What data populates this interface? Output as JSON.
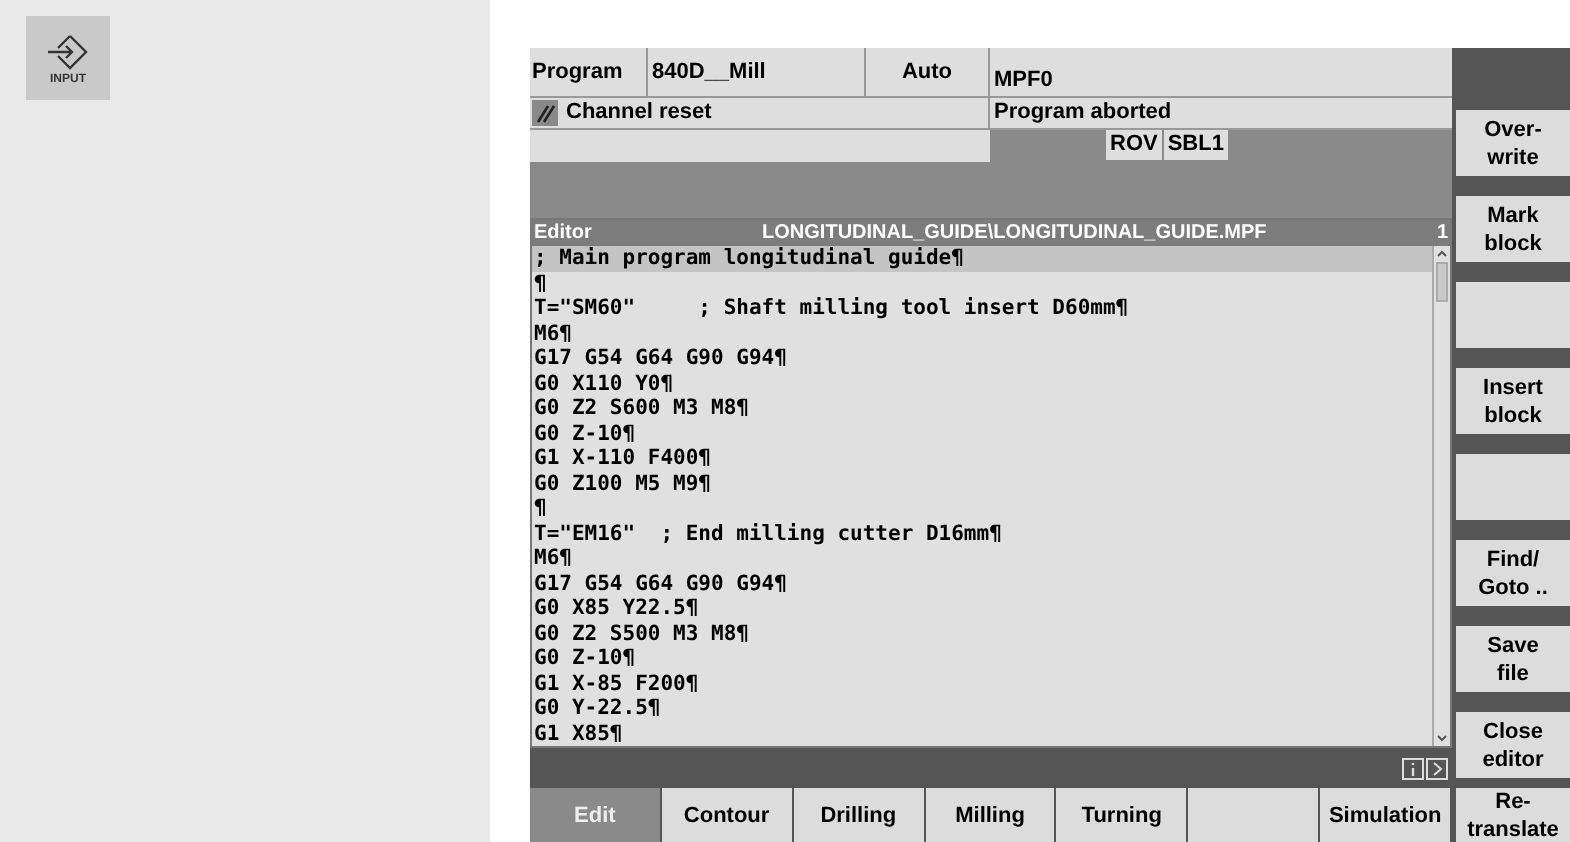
{
  "input_key": {
    "label": "INPUT"
  },
  "header": {
    "area": "Program",
    "machine": "840D__Mill",
    "mode": "Auto",
    "program_name": "MPF0",
    "channel_status": "Channel reset",
    "program_status": "Program aborted",
    "indicators": [
      "ROV",
      "SBL1"
    ]
  },
  "editor": {
    "title": "Editor",
    "file_path": "LONGITUDINAL_GUIDE\\LONGITUDINAL_GUIDE.MPF",
    "channel": "1",
    "lines": [
      {
        "text": "; Main program longitudinal guide¶",
        "selected": true
      },
      {
        "text": "¶",
        "selected": false
      },
      {
        "text": "T=\"SM60\"     ; Shaft milling tool insert D60mm¶",
        "selected": false
      },
      {
        "text": "M6¶",
        "selected": false
      },
      {
        "text": "G17 G54 G64 G90 G94¶",
        "selected": false
      },
      {
        "text": "G0 X110 Y0¶",
        "selected": false
      },
      {
        "text": "G0 Z2 S600 M3 M8¶",
        "selected": false
      },
      {
        "text": "G0 Z-10¶",
        "selected": false
      },
      {
        "text": "G1 X-110 F400¶",
        "selected": false
      },
      {
        "text": "G0 Z100 M5 M9¶",
        "selected": false
      },
      {
        "text": "¶",
        "selected": false
      },
      {
        "text": "T=\"EM16\"  ; End milling cutter D16mm¶",
        "selected": false
      },
      {
        "text": "M6¶",
        "selected": false
      },
      {
        "text": "G17 G54 G64 G90 G94¶",
        "selected": false
      },
      {
        "text": "G0 X85 Y22.5¶",
        "selected": false
      },
      {
        "text": "G0 Z2 S500 M3 M8¶",
        "selected": false
      },
      {
        "text": "G0 Z-10¶",
        "selected": false
      },
      {
        "text": "G1 X-85 F200¶",
        "selected": false
      },
      {
        "text": "G0 Y-22.5¶",
        "selected": false
      },
      {
        "text": "G1 X85¶",
        "selected": false
      }
    ]
  },
  "softkeys_bottom": [
    {
      "kind": "key",
      "label": "Edit",
      "selected": true
    },
    {
      "kind": "key",
      "label": "Contour",
      "selected": false
    },
    {
      "kind": "key",
      "label": "Drilling",
      "selected": false
    },
    {
      "kind": "key",
      "label": "Milling",
      "selected": false
    },
    {
      "kind": "key",
      "label": "Turning",
      "selected": false
    },
    {
      "kind": "blank",
      "selected": false
    },
    {
      "kind": "key",
      "label": "Simulation",
      "selected": false
    }
  ],
  "softkeys_right": [
    {
      "kind": "key",
      "label": "Over-\nwrite"
    },
    {
      "kind": "key",
      "label": "Mark\nblock"
    },
    {
      "kind": "blank"
    },
    {
      "kind": "key",
      "label": "Insert\nblock"
    },
    {
      "kind": "blank"
    },
    {
      "kind": "key",
      "label": "Find/\nGoto .."
    },
    {
      "kind": "key",
      "label": "Save\nfile"
    },
    {
      "kind": "key",
      "label": "Close\neditor"
    },
    {
      "kind": "key",
      "label": "Re-\ntranslate"
    }
  ]
}
